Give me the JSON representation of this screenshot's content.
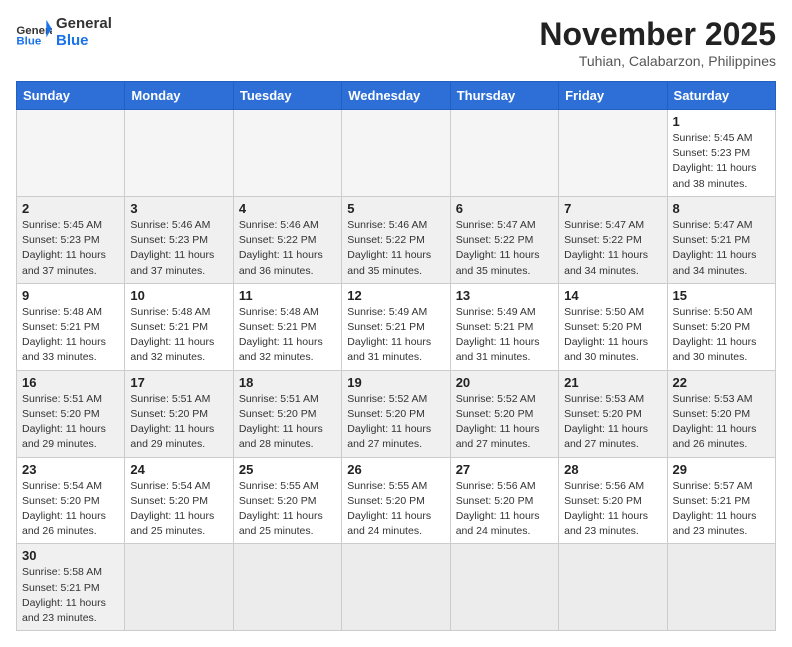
{
  "header": {
    "logo_general": "General",
    "logo_blue": "Blue",
    "month_title": "November 2025",
    "location": "Tuhian, Calabarzon, Philippines"
  },
  "weekdays": [
    "Sunday",
    "Monday",
    "Tuesday",
    "Wednesday",
    "Thursday",
    "Friday",
    "Saturday"
  ],
  "weeks": [
    [
      {
        "day": "",
        "info": ""
      },
      {
        "day": "",
        "info": ""
      },
      {
        "day": "",
        "info": ""
      },
      {
        "day": "",
        "info": ""
      },
      {
        "day": "",
        "info": ""
      },
      {
        "day": "",
        "info": ""
      },
      {
        "day": "1",
        "info": "Sunrise: 5:45 AM\nSunset: 5:23 PM\nDaylight: 11 hours\nand 38 minutes."
      }
    ],
    [
      {
        "day": "2",
        "info": "Sunrise: 5:45 AM\nSunset: 5:23 PM\nDaylight: 11 hours\nand 37 minutes."
      },
      {
        "day": "3",
        "info": "Sunrise: 5:46 AM\nSunset: 5:23 PM\nDaylight: 11 hours\nand 37 minutes."
      },
      {
        "day": "4",
        "info": "Sunrise: 5:46 AM\nSunset: 5:22 PM\nDaylight: 11 hours\nand 36 minutes."
      },
      {
        "day": "5",
        "info": "Sunrise: 5:46 AM\nSunset: 5:22 PM\nDaylight: 11 hours\nand 35 minutes."
      },
      {
        "day": "6",
        "info": "Sunrise: 5:47 AM\nSunset: 5:22 PM\nDaylight: 11 hours\nand 35 minutes."
      },
      {
        "day": "7",
        "info": "Sunrise: 5:47 AM\nSunset: 5:22 PM\nDaylight: 11 hours\nand 34 minutes."
      },
      {
        "day": "8",
        "info": "Sunrise: 5:47 AM\nSunset: 5:21 PM\nDaylight: 11 hours\nand 34 minutes."
      }
    ],
    [
      {
        "day": "9",
        "info": "Sunrise: 5:48 AM\nSunset: 5:21 PM\nDaylight: 11 hours\nand 33 minutes."
      },
      {
        "day": "10",
        "info": "Sunrise: 5:48 AM\nSunset: 5:21 PM\nDaylight: 11 hours\nand 32 minutes."
      },
      {
        "day": "11",
        "info": "Sunrise: 5:48 AM\nSunset: 5:21 PM\nDaylight: 11 hours\nand 32 minutes."
      },
      {
        "day": "12",
        "info": "Sunrise: 5:49 AM\nSunset: 5:21 PM\nDaylight: 11 hours\nand 31 minutes."
      },
      {
        "day": "13",
        "info": "Sunrise: 5:49 AM\nSunset: 5:21 PM\nDaylight: 11 hours\nand 31 minutes."
      },
      {
        "day": "14",
        "info": "Sunrise: 5:50 AM\nSunset: 5:20 PM\nDaylight: 11 hours\nand 30 minutes."
      },
      {
        "day": "15",
        "info": "Sunrise: 5:50 AM\nSunset: 5:20 PM\nDaylight: 11 hours\nand 30 minutes."
      }
    ],
    [
      {
        "day": "16",
        "info": "Sunrise: 5:51 AM\nSunset: 5:20 PM\nDaylight: 11 hours\nand 29 minutes."
      },
      {
        "day": "17",
        "info": "Sunrise: 5:51 AM\nSunset: 5:20 PM\nDaylight: 11 hours\nand 29 minutes."
      },
      {
        "day": "18",
        "info": "Sunrise: 5:51 AM\nSunset: 5:20 PM\nDaylight: 11 hours\nand 28 minutes."
      },
      {
        "day": "19",
        "info": "Sunrise: 5:52 AM\nSunset: 5:20 PM\nDaylight: 11 hours\nand 27 minutes."
      },
      {
        "day": "20",
        "info": "Sunrise: 5:52 AM\nSunset: 5:20 PM\nDaylight: 11 hours\nand 27 minutes."
      },
      {
        "day": "21",
        "info": "Sunrise: 5:53 AM\nSunset: 5:20 PM\nDaylight: 11 hours\nand 27 minutes."
      },
      {
        "day": "22",
        "info": "Sunrise: 5:53 AM\nSunset: 5:20 PM\nDaylight: 11 hours\nand 26 minutes."
      }
    ],
    [
      {
        "day": "23",
        "info": "Sunrise: 5:54 AM\nSunset: 5:20 PM\nDaylight: 11 hours\nand 26 minutes."
      },
      {
        "day": "24",
        "info": "Sunrise: 5:54 AM\nSunset: 5:20 PM\nDaylight: 11 hours\nand 25 minutes."
      },
      {
        "day": "25",
        "info": "Sunrise: 5:55 AM\nSunset: 5:20 PM\nDaylight: 11 hours\nand 25 minutes."
      },
      {
        "day": "26",
        "info": "Sunrise: 5:55 AM\nSunset: 5:20 PM\nDaylight: 11 hours\nand 24 minutes."
      },
      {
        "day": "27",
        "info": "Sunrise: 5:56 AM\nSunset: 5:20 PM\nDaylight: 11 hours\nand 24 minutes."
      },
      {
        "day": "28",
        "info": "Sunrise: 5:56 AM\nSunset: 5:20 PM\nDaylight: 11 hours\nand 23 minutes."
      },
      {
        "day": "29",
        "info": "Sunrise: 5:57 AM\nSunset: 5:21 PM\nDaylight: 11 hours\nand 23 minutes."
      }
    ],
    [
      {
        "day": "30",
        "info": "Sunrise: 5:58 AM\nSunset: 5:21 PM\nDaylight: 11 hours\nand 23 minutes."
      },
      {
        "day": "",
        "info": ""
      },
      {
        "day": "",
        "info": ""
      },
      {
        "day": "",
        "info": ""
      },
      {
        "day": "",
        "info": ""
      },
      {
        "day": "",
        "info": ""
      },
      {
        "day": "",
        "info": ""
      }
    ]
  ]
}
